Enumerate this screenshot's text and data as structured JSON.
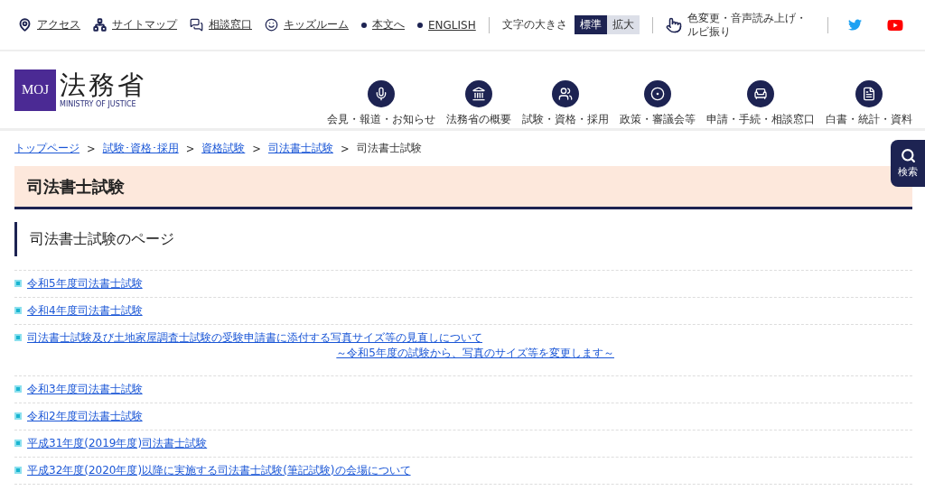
{
  "utility_nav": [
    {
      "label": "アクセス"
    },
    {
      "label": "サイトマップ"
    },
    {
      "label": "相談窓口"
    },
    {
      "label": "キッズルーム"
    },
    {
      "label": "本文へ"
    },
    {
      "label": "ENGLISH"
    }
  ],
  "text_size": {
    "label": "文字の大きさ",
    "options": [
      {
        "label": "標準",
        "selected": true
      },
      {
        "label": "拡大",
        "selected": false
      }
    ]
  },
  "accessibility": {
    "label": "色変更・音声読み上げ・ルビ振り"
  },
  "logo": {
    "mark": "MOJ",
    "name": "法務省",
    "subtitle": "MINISTRY OF JUSTICE"
  },
  "main_nav": [
    {
      "label": "会見・報道・お知らせ"
    },
    {
      "label": "法務省の概要"
    },
    {
      "label": "試験・資格・採用"
    },
    {
      "label": "政策・審議会等"
    },
    {
      "label": "申請・手続・相談窓口"
    },
    {
      "label": "白書・統計・資料"
    }
  ],
  "search_tab": {
    "label": "検索"
  },
  "breadcrumb": [
    {
      "label": "トップページ",
      "kind": "link"
    },
    {
      "label": "試験･資格･採用",
      "kind": "link"
    },
    {
      "label": "資格試験",
      "kind": "link"
    },
    {
      "label": "司法書士試験",
      "kind": "link"
    },
    {
      "label": "司法書士試験",
      "kind": "current"
    }
  ],
  "breadcrumb_separator": ">",
  "page_title": "司法書士試験",
  "section_heading": "司法書士試験のページ",
  "links": [
    {
      "label": "令和5年度司法書士試験"
    },
    {
      "label": "令和4年度司法書士試験"
    },
    {
      "label": "司法書士試験及び土地家屋調査士試験の受験申請書に添付する写真サイズ等の見直しについて",
      "subtitle": "～令和5年度の試験から、写真のサイズ等を変更します～"
    },
    {
      "label": "令和3年度司法書士試験"
    },
    {
      "label": "令和2年度司法書士試験"
    },
    {
      "label": "平成31年度(2019年度)司法書士試験"
    },
    {
      "label": "平成32年度(2020年度)以降に実施する司法書士試験(筆記試験)の会場について"
    }
  ]
}
